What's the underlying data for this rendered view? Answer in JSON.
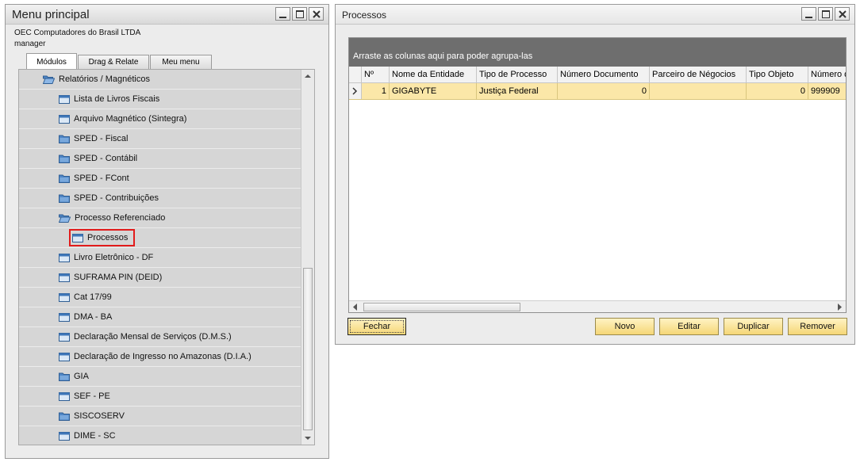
{
  "menu_window": {
    "title": "Menu principal",
    "company": "OEC Computadores do Brasil LTDA",
    "user": "manager",
    "tabs": [
      {
        "label": "Módulos"
      },
      {
        "label": "Drag & Relate"
      },
      {
        "label": "Meu menu"
      }
    ],
    "tree": [
      {
        "label": "Relatórios / Magnéticos",
        "icon": "folder-open-icon",
        "level": 0
      },
      {
        "label": "Lista de Livros Fiscais",
        "icon": "form-icon",
        "level": 1
      },
      {
        "label": "Arquivo Magnético (Sintegra)",
        "icon": "form-icon",
        "level": 1
      },
      {
        "label": "SPED - Fiscal",
        "icon": "folder-icon",
        "level": 1
      },
      {
        "label": "SPED - Contábil",
        "icon": "folder-icon",
        "level": 1
      },
      {
        "label": "SPED - FCont",
        "icon": "folder-icon",
        "level": 1
      },
      {
        "label": "SPED - Contribuições",
        "icon": "folder-icon",
        "level": 1
      },
      {
        "label": "Processo Referenciado",
        "icon": "folder-open-icon",
        "level": 1
      },
      {
        "label": "Processos",
        "icon": "form-icon",
        "level": 2,
        "selected": true
      },
      {
        "label": "Livro Eletrônico - DF",
        "icon": "form-icon",
        "level": 1
      },
      {
        "label": "SUFRAMA PIN (DEID)",
        "icon": "form-icon",
        "level": 1
      },
      {
        "label": "Cat 17/99",
        "icon": "form-icon",
        "level": 1
      },
      {
        "label": "DMA - BA",
        "icon": "form-icon",
        "level": 1
      },
      {
        "label": "Declaração Mensal de Serviços (D.M.S.)",
        "icon": "form-icon",
        "level": 1
      },
      {
        "label": "Declaração de Ingresso no Amazonas (D.I.A.)",
        "icon": "form-icon",
        "level": 1
      },
      {
        "label": "GIA",
        "icon": "folder-icon",
        "level": 1
      },
      {
        "label": "SEF - PE",
        "icon": "form-icon",
        "level": 1
      },
      {
        "label": "SISCOSERV",
        "icon": "folder-icon",
        "level": 1
      },
      {
        "label": "DIME - SC",
        "icon": "form-icon",
        "level": 1
      }
    ]
  },
  "process_window": {
    "title": "Processos",
    "group_hint": "Arraste as colunas aqui para poder agrupa-las",
    "columns": [
      "Nº",
      "Nome da Entidade",
      "Tipo de Processo",
      "Número Documento",
      "Parceiro de Négocios",
      "Tipo Objeto",
      "Número d"
    ],
    "rows": [
      [
        "1",
        "GIGABYTE",
        "Justiça Federal",
        "0",
        "",
        "0",
        "999909"
      ]
    ],
    "buttons": {
      "close": "Fechar",
      "new": "Novo",
      "edit": "Editar",
      "duplicate": "Duplicar",
      "remove": "Remover"
    }
  },
  "colors": {
    "group_bar": "#6e6e6e",
    "selected_row": "#fbe7a8",
    "button": "#f5d676",
    "highlight": "#e21b1b"
  }
}
